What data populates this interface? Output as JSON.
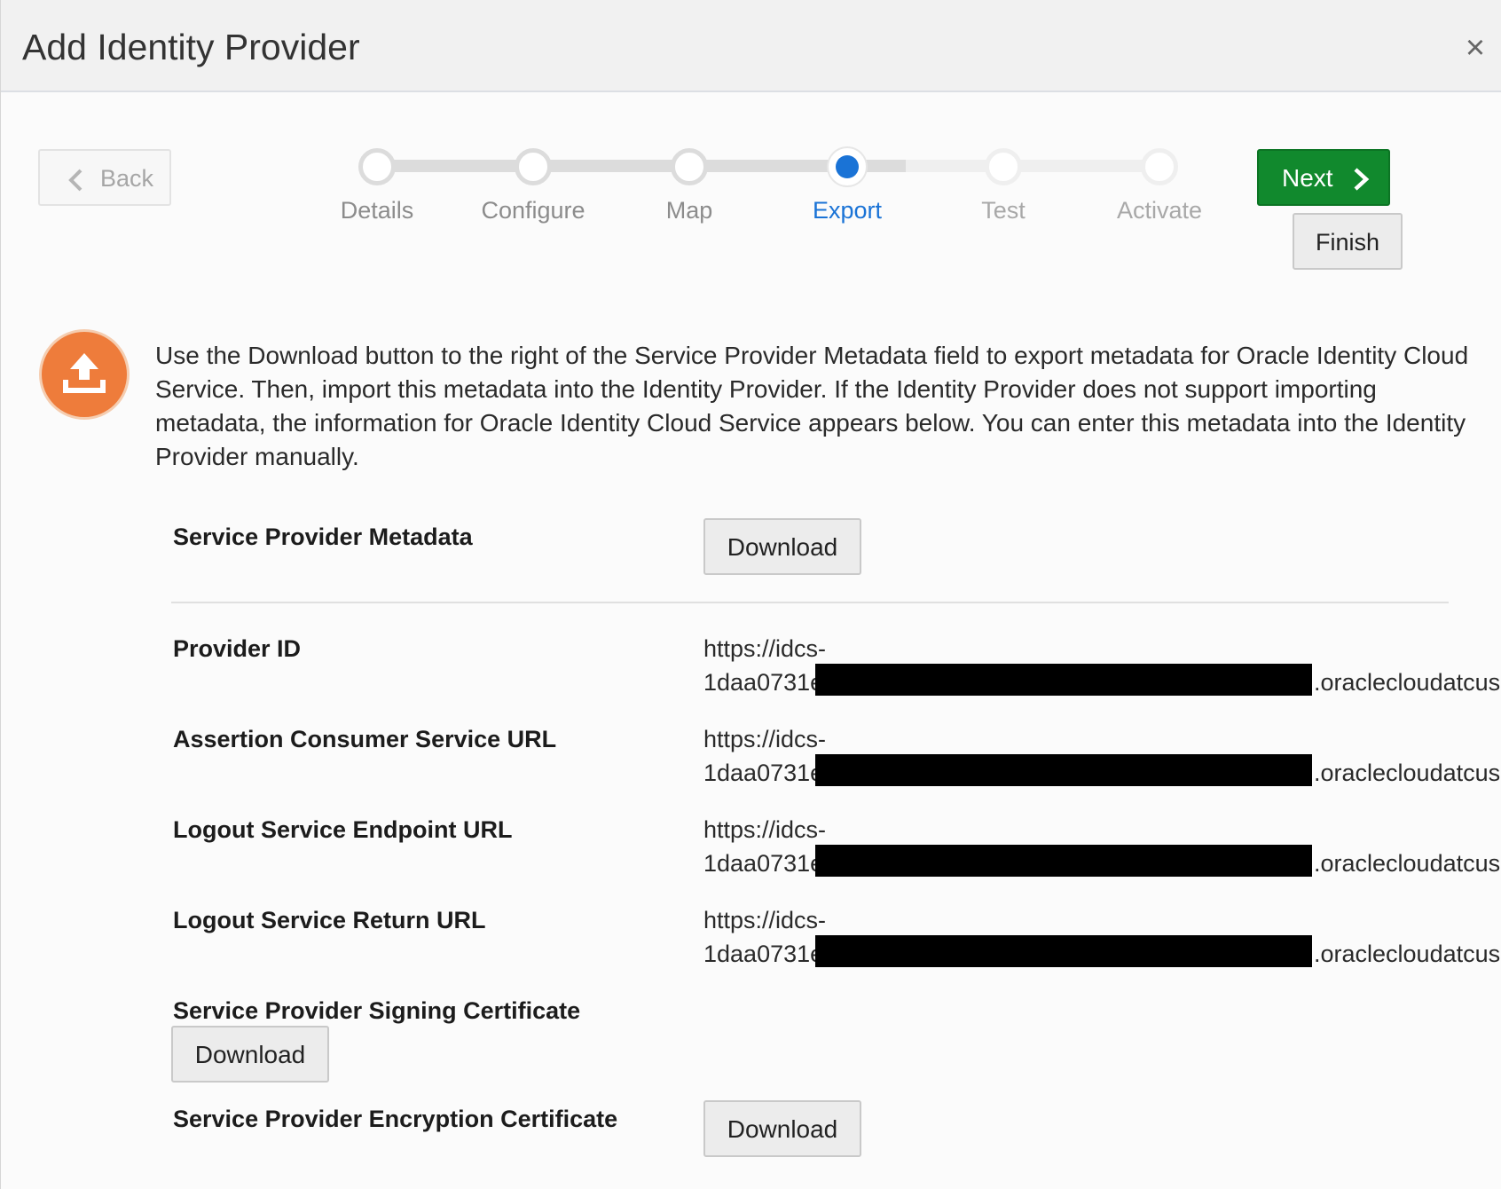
{
  "dialog": {
    "title": "Add Identity Provider",
    "close_glyph": "×"
  },
  "nav": {
    "back_label": "Back",
    "next_label": "Next",
    "finish_label": "Finish"
  },
  "train": {
    "steps": [
      {
        "label": "Details",
        "state": "visited"
      },
      {
        "label": "Configure",
        "state": "visited"
      },
      {
        "label": "Map",
        "state": "visited"
      },
      {
        "label": "Export",
        "state": "current"
      },
      {
        "label": "Test",
        "state": "unvisited"
      },
      {
        "label": "Activate",
        "state": "unvisited"
      }
    ]
  },
  "info": {
    "icon": "upload-icon",
    "text": "Use the Download button to the right of the Service Provider Metadata field to export metadata for Oracle Identity Cloud Service. Then, import this metadata into the Identity Provider. If the Identity Provider does not support importing metadata, the information for Oracle Identity Cloud Service appears below. You can enter this metadata into the Identity Provider manually."
  },
  "form": {
    "metadata": {
      "label": "Service Provider Metadata",
      "button": "Download"
    },
    "provider_id": {
      "label": "Provider ID",
      "line1": "https://idcs-",
      "line2_start": "1daa0731e",
      "line2_end": ".oraclecloudatcus"
    },
    "acs_url": {
      "label": "Assertion Consumer Service URL",
      "line1": "https://idcs-",
      "line2_start": "1daa0731e",
      "line2_end": ".oraclecloudatcus"
    },
    "logout_endpoint": {
      "label": "Logout Service Endpoint URL",
      "line1": "https://idcs-",
      "line2_start": "1daa0731e",
      "line2_end": ".oraclecloudatcus"
    },
    "logout_return": {
      "label": "Logout Service Return URL",
      "line1": "https://idcs-",
      "line2_start": "1daa0731e",
      "line2_end": ".oraclecloudatcus"
    },
    "signing_cert": {
      "label": "Service Provider Signing Certificate",
      "button": "Download"
    },
    "encryption_cert": {
      "label": "Service Provider Encryption Certificate",
      "button": "Download"
    }
  },
  "colors": {
    "accent_blue": "#1a73d6",
    "next_green": "#11892d",
    "info_orange": "#ee7c3b"
  }
}
